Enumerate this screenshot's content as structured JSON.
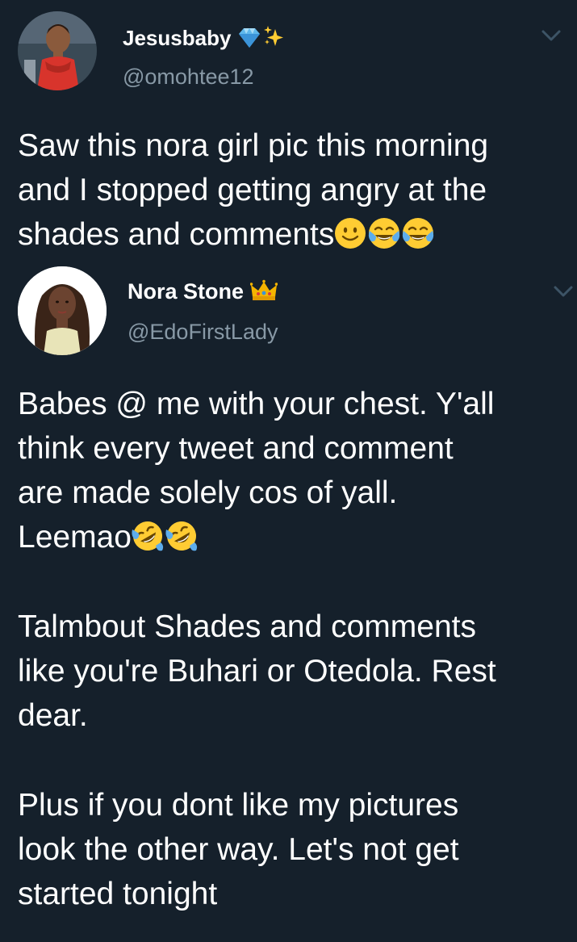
{
  "tweets": [
    {
      "display_name": "Jesusbaby",
      "name_icons": [
        "gem-icon",
        "sparkles-icon"
      ],
      "handle": "@omohtee12",
      "text_lines": [
        "Saw this nora girl pic this morning",
        "and I stopped getting angry at the",
        "shades and comments"
      ],
      "text_emojis": [
        "slightly-smiling-face-icon",
        "face-with-tears-of-joy-icon",
        "face-with-tears-of-joy-icon"
      ]
    },
    {
      "display_name": "Nora Stone",
      "name_icons": [
        "crown-icon"
      ],
      "handle": "@EdoFirstLady",
      "paragraphs": [
        {
          "lines": [
            "Babes @ me with your chest. Y'all",
            "think every tweet and comment",
            "are made solely cos of yall.",
            "Leemao"
          ],
          "emojis": [
            "rolling-on-floor-laughing-icon",
            "rolling-on-floor-laughing-icon"
          ]
        },
        {
          "lines": [
            "Talmbout Shades and comments",
            "like you're Buhari or Otedola. Rest",
            "dear."
          ]
        },
        {
          "lines": [
            "Plus if you dont like my pictures",
            "look the other way. Let's not get",
            "started tonight"
          ]
        }
      ]
    }
  ],
  "colors": {
    "background": "#15202b",
    "text": "#ffffff",
    "secondary_text": "#8899a6",
    "emoji_yellow": "#ffcc33",
    "tear_blue": "#5dadec"
  }
}
